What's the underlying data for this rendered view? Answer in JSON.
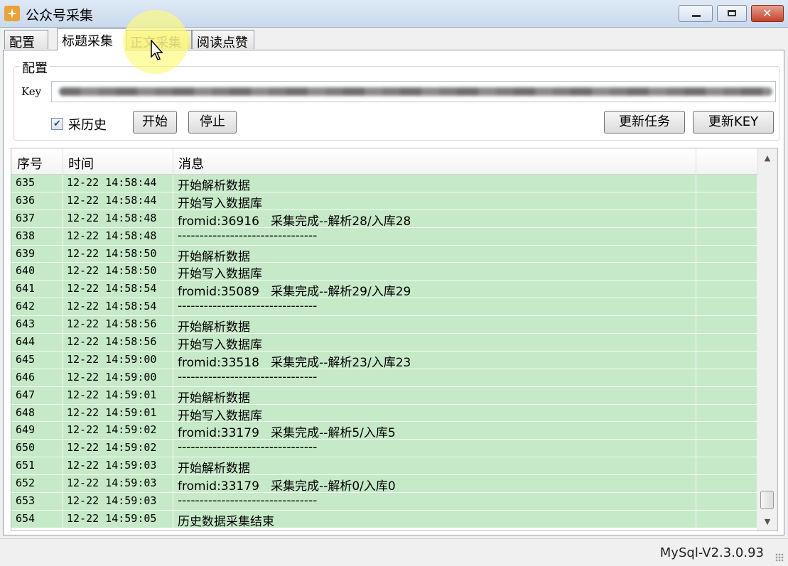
{
  "window": {
    "title": "公众号采集"
  },
  "tabs": [
    {
      "label": "配置"
    },
    {
      "label": "标题采集"
    },
    {
      "label": "正文采集"
    },
    {
      "label": "阅读点赞"
    }
  ],
  "config": {
    "legend": "配置",
    "key_label": "Key",
    "key_value": "",
    "history_checkbox_label": "采历史",
    "history_checked": true,
    "start_label": "开始",
    "stop_label": "停止",
    "update_task_label": "更新任务",
    "update_key_label": "更新KEY"
  },
  "log": {
    "columns": [
      "序号",
      "时间",
      "消息"
    ],
    "rows": [
      [
        "635",
        "12-22 14:58:44",
        "开始解析数据"
      ],
      [
        "636",
        "12-22 14:58:44",
        "开始写入数据库"
      ],
      [
        "637",
        "12-22 14:58:48",
        "fromid:36916   采集完成--解析28/入库28"
      ],
      [
        "638",
        "12-22 14:58:48",
        "--------------------------------"
      ],
      [
        "639",
        "12-22 14:58:50",
        "开始解析数据"
      ],
      [
        "640",
        "12-22 14:58:50",
        "开始写入数据库"
      ],
      [
        "641",
        "12-22 14:58:54",
        "fromid:35089   采集完成--解析29/入库29"
      ],
      [
        "642",
        "12-22 14:58:54",
        "--------------------------------"
      ],
      [
        "643",
        "12-22 14:58:56",
        "开始解析数据"
      ],
      [
        "644",
        "12-22 14:58:56",
        "开始写入数据库"
      ],
      [
        "645",
        "12-22 14:59:00",
        "fromid:33518   采集完成--解析23/入库23"
      ],
      [
        "646",
        "12-22 14:59:00",
        "--------------------------------"
      ],
      [
        "647",
        "12-22 14:59:01",
        "开始解析数据"
      ],
      [
        "648",
        "12-22 14:59:01",
        "开始写入数据库"
      ],
      [
        "649",
        "12-22 14:59:02",
        "fromid:33179   采集完成--解析5/入库5"
      ],
      [
        "650",
        "12-22 14:59:02",
        "--------------------------------"
      ],
      [
        "651",
        "12-22 14:59:03",
        "开始解析数据"
      ],
      [
        "652",
        "12-22 14:59:03",
        "fromid:33179   采集完成--解析0/入库0"
      ],
      [
        "653",
        "12-22 14:59:03",
        "--------------------------------"
      ],
      [
        "654",
        "12-22 14:59:05",
        "历史数据采集结束"
      ]
    ]
  },
  "status": {
    "text": "MySql-V2.3.0.93"
  },
  "colors": {
    "row_bg": "#c6e9c8",
    "tab_hover": "#ecea9f"
  },
  "icons": {
    "app": "app-logo-icon",
    "minimize": "minimize-icon",
    "maximize": "maximize-icon",
    "close": "close-icon"
  }
}
